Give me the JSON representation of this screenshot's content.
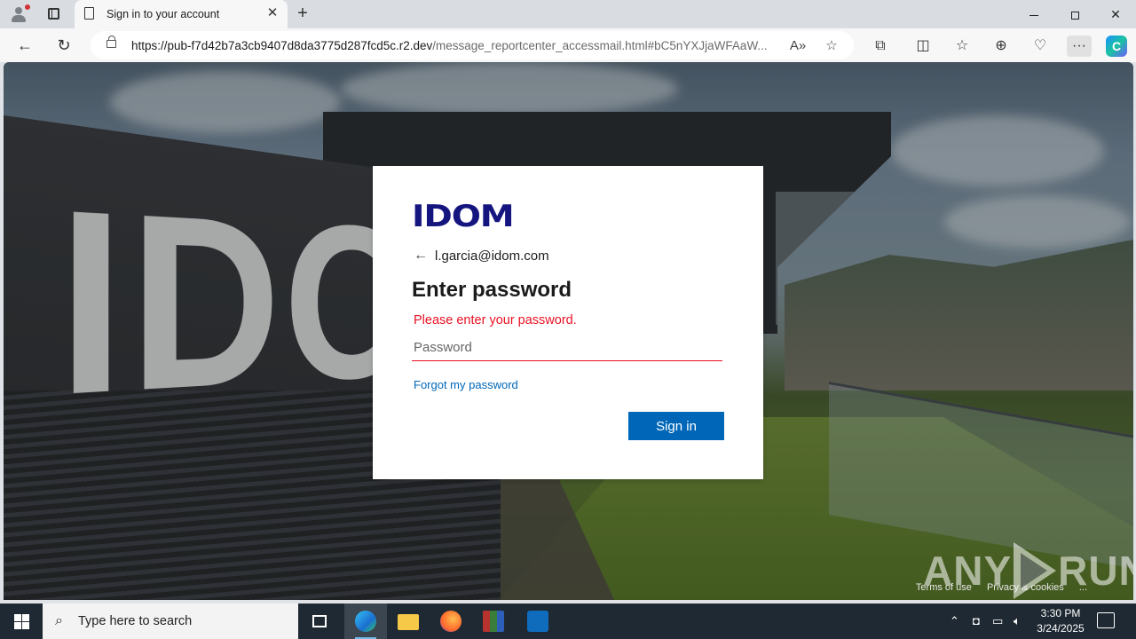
{
  "browser": {
    "tab_title": "Sign in to your account",
    "url_host": "https://pub-f7d42b7a3cb9407d8da3775d287fcd5c.r2.dev",
    "url_path": "/message_reportcenter_accessmail.html#bC5nYXJjaWFAaW..."
  },
  "card": {
    "logo_text": "IDOM",
    "email": "l.garcia@idom.com",
    "heading": "Enter password",
    "error": "Please enter your password.",
    "password_placeholder": "Password",
    "forgot_link": "Forgot my password",
    "signin_button": "Sign in"
  },
  "page_footer": {
    "terms": "Terms of use",
    "privacy": "Privacy & cookies",
    "more": "..."
  },
  "watermark": {
    "left": "ANY",
    "right": "RUN"
  },
  "taskbar": {
    "search_placeholder": "Type here to search",
    "time": "3:30 PM",
    "date": "3/24/2025"
  },
  "colors": {
    "error": "#e81123",
    "link": "#0067b8",
    "button": "#0067b8",
    "logo": "#151580"
  }
}
